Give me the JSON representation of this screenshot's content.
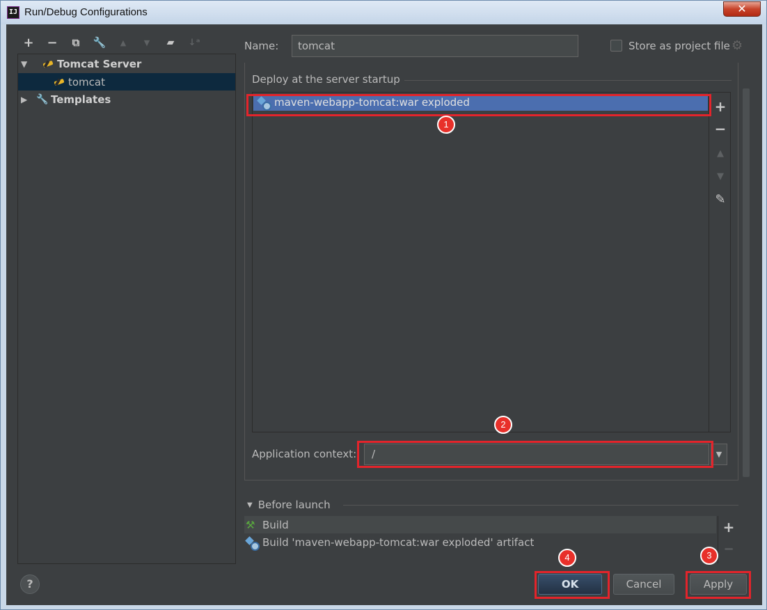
{
  "window": {
    "title": "Run/Debug Configurations",
    "app_icon": "intellij-icon",
    "close_label": "✕"
  },
  "toolbar": {
    "items": [
      {
        "icon": "add-icon",
        "glyph": "+"
      },
      {
        "icon": "remove-icon",
        "glyph": "−"
      },
      {
        "icon": "copy-icon",
        "glyph": "⧉"
      },
      {
        "icon": "wrench-icon",
        "glyph": "🔧"
      },
      {
        "icon": "move-up-icon",
        "glyph": "▲"
      },
      {
        "icon": "move-down-icon",
        "glyph": "▼"
      },
      {
        "icon": "folder-add-icon",
        "glyph": "▰"
      },
      {
        "icon": "sort-icon",
        "glyph": "↓ᵃ"
      }
    ]
  },
  "tree": {
    "group_label": "Tomcat Server",
    "child_label": "tomcat",
    "templates_label": "Templates"
  },
  "config": {
    "name_label": "Name:",
    "name_value": "tomcat",
    "store_label": "Store as project file"
  },
  "deploy": {
    "section_title": "Deploy at the server startup",
    "items": [
      "maven-webapp-tomcat:war exploded"
    ],
    "side_buttons": [
      "+",
      "−",
      "▲",
      "▼",
      "✎"
    ]
  },
  "context": {
    "label": "Application context:",
    "value": "/"
  },
  "before_launch": {
    "title": "Before launch",
    "items": [
      "Build",
      "Build 'maven-webapp-tomcat:war exploded' artifact"
    ],
    "side_buttons": [
      "+",
      "−"
    ]
  },
  "buttons": {
    "help": "?",
    "ok": "OK",
    "cancel": "Cancel",
    "apply": "Apply"
  },
  "annotations": [
    "1",
    "2",
    "3",
    "4"
  ],
  "colors": {
    "accent_selection": "#4b6eaf",
    "annotation_red": "#e3242b",
    "background": "#3c3f41"
  }
}
